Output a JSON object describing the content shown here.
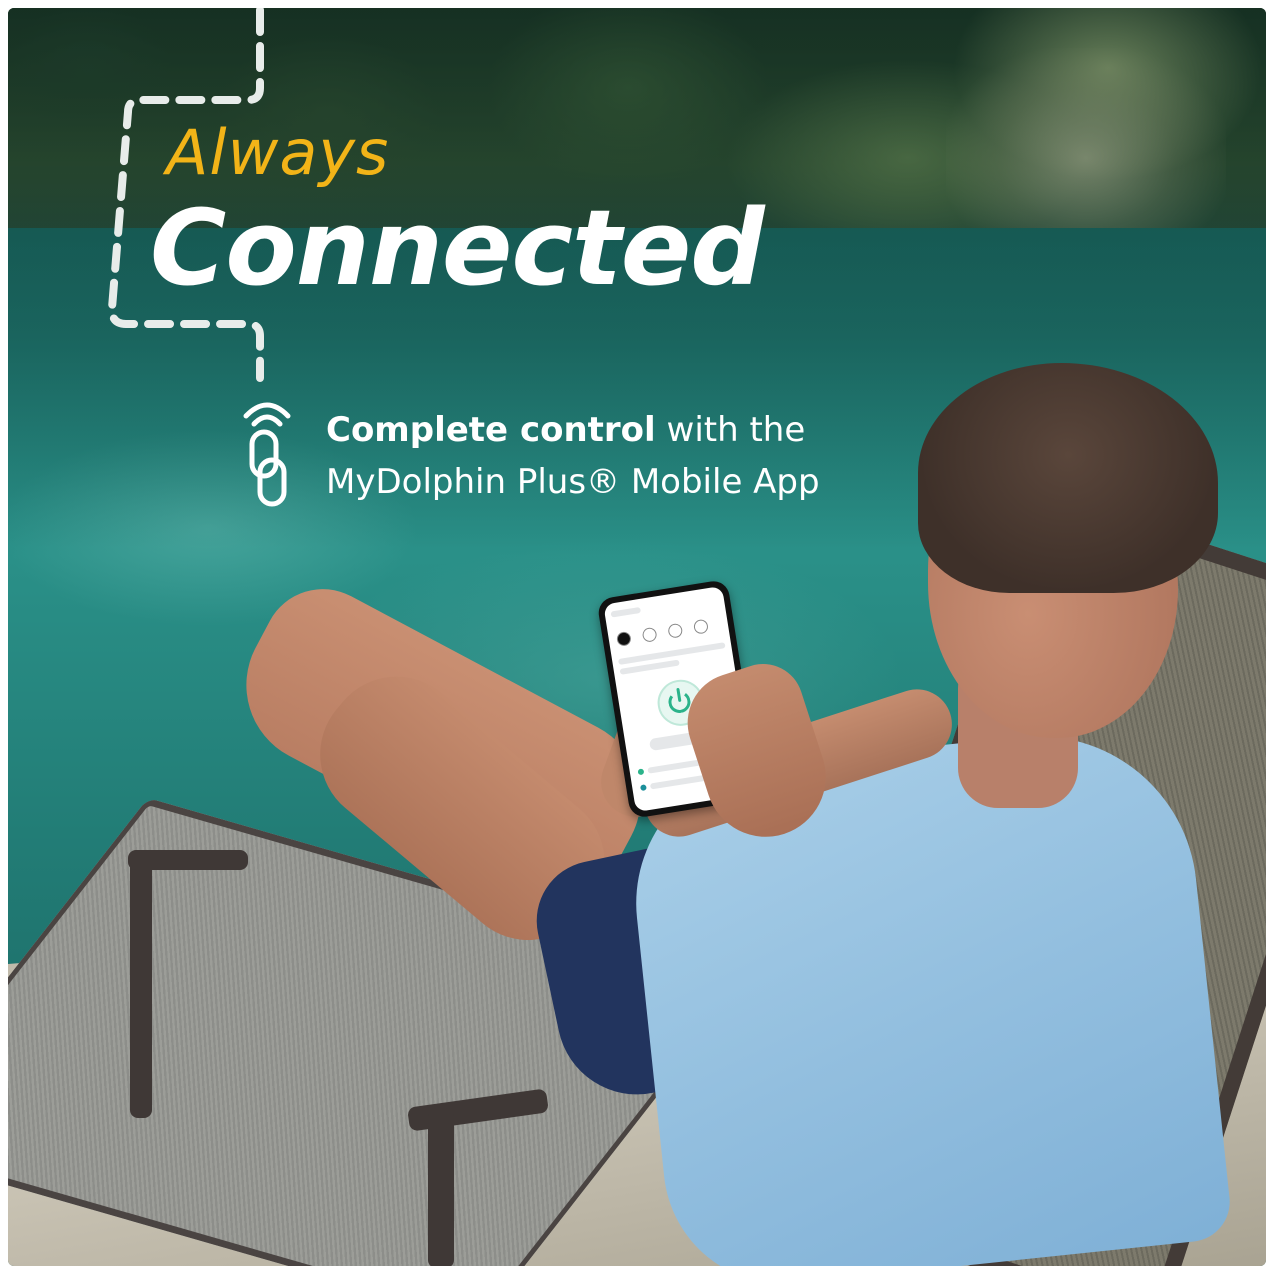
{
  "headline": {
    "line1": "Always",
    "line2": "Connected"
  },
  "subtitle": {
    "bold": "Complete control",
    "rest_line1": " with the",
    "line2": "MyDolphin Plus® Mobile App"
  },
  "icons": {
    "connect": "wireless-link-icon"
  },
  "colors": {
    "accent_yellow": "#f2b418",
    "text_white": "#ffffff",
    "app_green": "#2bb38a"
  }
}
